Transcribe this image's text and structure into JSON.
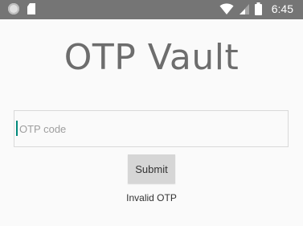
{
  "status_bar": {
    "time": "6:45",
    "icons": [
      "circle-icon",
      "sd-card-icon",
      "wifi-icon",
      "cell-signal-icon",
      "battery-icon"
    ],
    "background": "#757575"
  },
  "app": {
    "title": "OTP Vault"
  },
  "form": {
    "otp_placeholder": "OTP code",
    "otp_value": "",
    "submit_label": "Submit",
    "message": "Invalid OTP"
  },
  "colors": {
    "accent": "#00897b",
    "title_text": "#6d6d6d",
    "button_bg": "#d6d6d6"
  }
}
